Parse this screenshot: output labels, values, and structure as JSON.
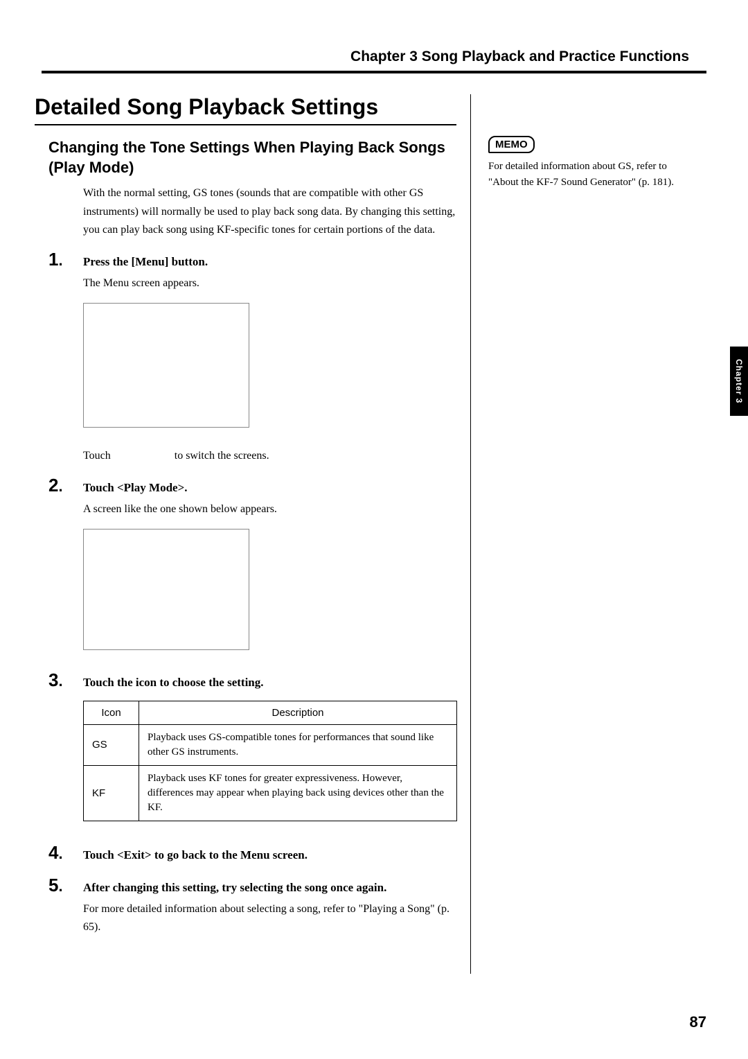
{
  "header": {
    "chapter_label": "Chapter 3 Song Playback and Practice Functions"
  },
  "section": {
    "title": "Detailed Song Playback Settings",
    "subtitle": "Changing the Tone Settings When Playing Back Songs (Play Mode)",
    "intro": "With the normal setting, GS tones (sounds that are compatible with other GS instruments) will normally be used to play back song data. By changing this setting, you can play back song using KF-specific tones for certain portions of the data."
  },
  "steps": [
    {
      "num": "1",
      "text": "Press the [Menu] button.",
      "follow": "The Menu screen appears.",
      "has_image": true,
      "extra_after": "Touch                       to switch the screens."
    },
    {
      "num": "2",
      "text": "Touch <Play Mode>.",
      "follow": "A screen like the one shown below appears.",
      "has_image": true
    },
    {
      "num": "3",
      "text": "Touch the icon to choose the setting."
    },
    {
      "num": "4",
      "text": "Touch <Exit> to go back to the Menu screen."
    },
    {
      "num": "5",
      "text": "After changing this setting, try selecting the song once again.",
      "follow": "For more detailed information about selecting a song, refer to \"Playing a Song\" (p. 65)."
    }
  ],
  "table": {
    "headers": [
      "Icon",
      "Description"
    ],
    "rows": [
      {
        "icon": "GS",
        "desc": "Playback uses GS-compatible tones for performances that sound like other GS instruments."
      },
      {
        "icon": "KF",
        "desc": "Playback uses KF tones for greater expressiveness. However, differences may appear when playing back using devices other than the KF."
      }
    ]
  },
  "sidebar": {
    "memo_label": "MEMO",
    "memo_text": "For detailed information about GS, refer to \"About the KF-7 Sound Generator\" (p. 181)."
  },
  "thumb_tab": "Chapter 3",
  "page_number": "87"
}
